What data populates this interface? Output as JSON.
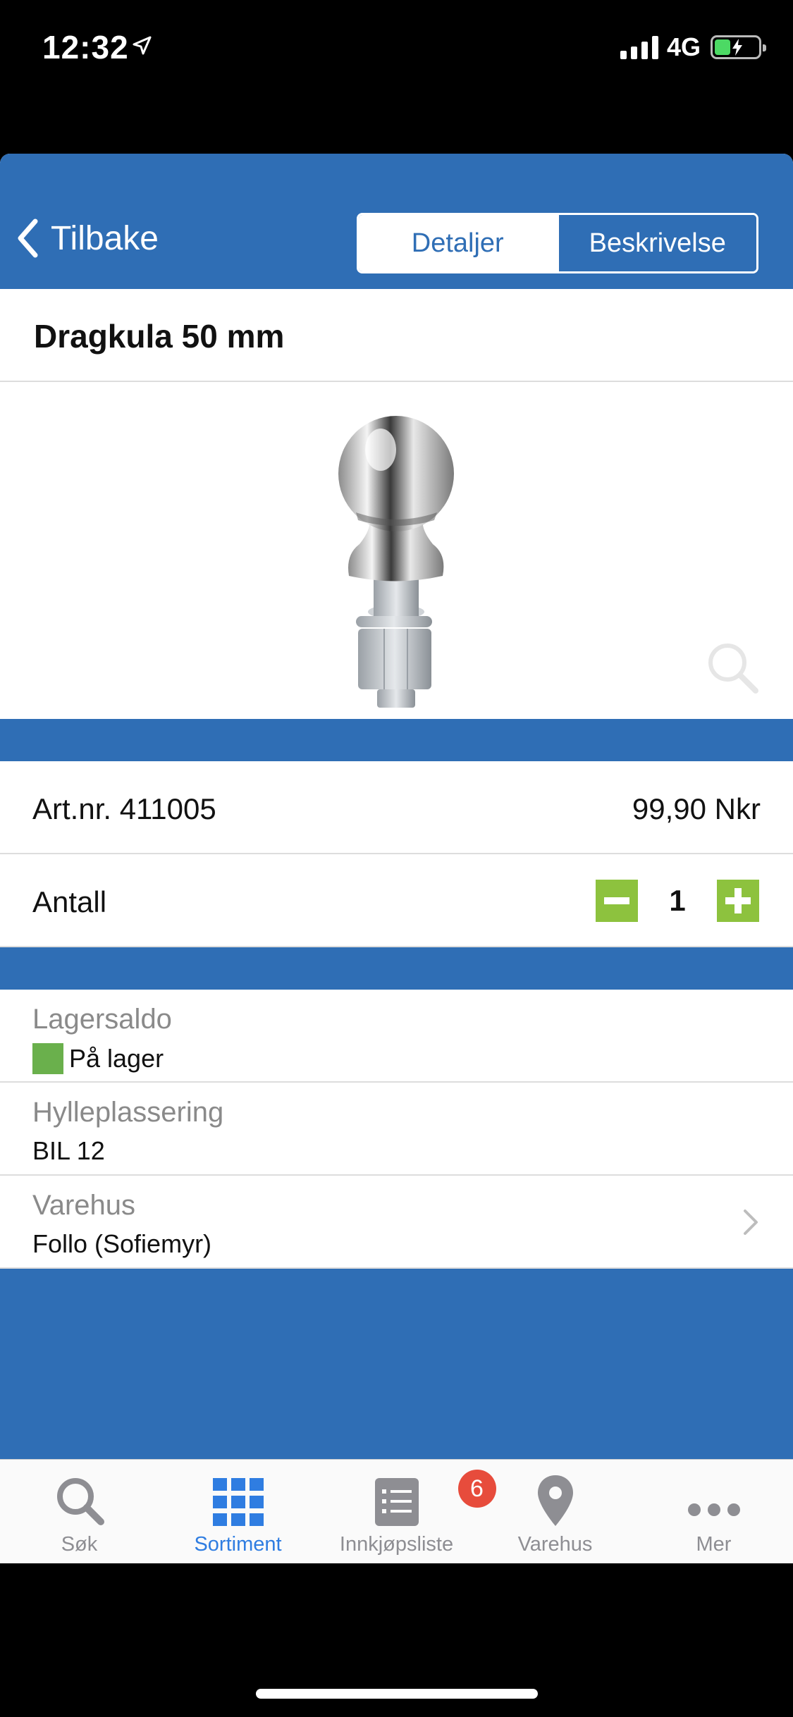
{
  "status_bar": {
    "time": "12:32",
    "network": "4G"
  },
  "nav": {
    "back_label": "Tilbake",
    "tabs": [
      "Detaljer",
      "Beskrivelse"
    ],
    "active_tab": "Detaljer"
  },
  "product": {
    "title": "Dragkula 50 mm",
    "article": "Art.nr. 411005",
    "price": "99,90 Nkr",
    "quantity_label": "Antall",
    "quantity": "1"
  },
  "info": {
    "stock_label": "Lagersaldo",
    "stock_value": "På lager",
    "stock_color": "#6ab04c",
    "shelf_label": "Hylleplassering",
    "shelf_value": "BIL 12",
    "warehouse_label": "Varehus",
    "warehouse_value": "Follo (Sofiemyr)"
  },
  "tabbar": {
    "items": [
      {
        "label": "Søk",
        "icon": "search-icon"
      },
      {
        "label": "Sortiment",
        "icon": "grid-icon",
        "active": true
      },
      {
        "label": "Innkjøpsliste",
        "icon": "list-icon",
        "badge": "6"
      },
      {
        "label": "Varehus",
        "icon": "location-pin-icon"
      },
      {
        "label": "Mer",
        "icon": "more-icon"
      }
    ]
  },
  "colors": {
    "brand_blue": "#2f6eb5",
    "accent_green": "#8dc23e",
    "tab_active": "#2f7de1",
    "badge_red": "#e74c3c"
  }
}
